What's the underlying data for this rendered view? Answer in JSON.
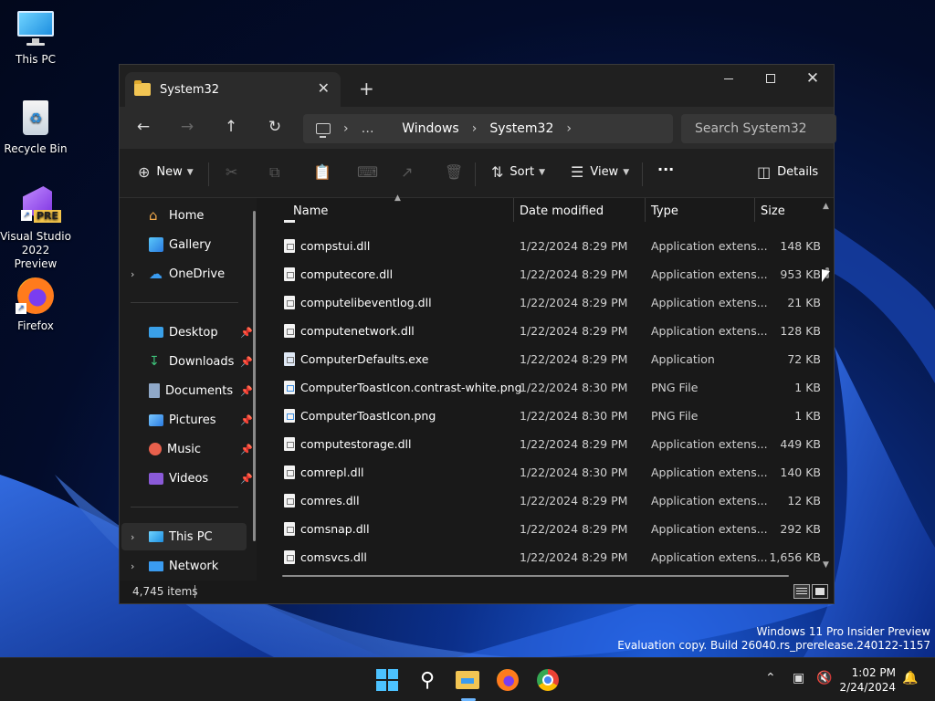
{
  "desktop": {
    "icons": [
      {
        "label": "This PC",
        "icon": "monitor-icon"
      },
      {
        "label": "Recycle Bin",
        "icon": "recycle-bin-icon"
      },
      {
        "label": "Visual Studio 2022 Preview",
        "badge": "PRE",
        "icon": "visual-studio-icon"
      },
      {
        "label": "Firefox",
        "icon": "firefox-icon"
      }
    ],
    "watermark_line1": "Windows 11 Pro Insider Preview",
    "watermark_line2": "Evaluation copy. Build 26040.rs_prerelease.240122-1157"
  },
  "window": {
    "tab_title": "System32",
    "new_tab": "+",
    "breadcrumb": [
      "Windows",
      "System32"
    ],
    "breadcrumb_more": "…",
    "search_placeholder": "Search System32",
    "toolbar": {
      "new_label": "New",
      "sort_label": "Sort",
      "view_label": "View",
      "more_label": "···",
      "details_label": "Details"
    },
    "nav": {
      "home": "Home",
      "gallery": "Gallery",
      "onedrive": "OneDrive",
      "desktop": "Desktop",
      "downloads": "Downloads",
      "documents": "Documents",
      "pictures": "Pictures",
      "music": "Music",
      "videos": "Videos",
      "this_pc": "This PC",
      "network": "Network"
    },
    "columns": {
      "name": "Name",
      "date": "Date modified",
      "type": "Type",
      "size": "Size"
    },
    "files": [
      {
        "name": "compstui.dll",
        "date": "1/22/2024 8:29 PM",
        "type": "Application extens...",
        "size": "148 KB",
        "kind": "dll"
      },
      {
        "name": "computecore.dll",
        "date": "1/22/2024 8:29 PM",
        "type": "Application extens...",
        "size": "953 KB",
        "kind": "dll"
      },
      {
        "name": "computelibeventlog.dll",
        "date": "1/22/2024 8:29 PM",
        "type": "Application extens...",
        "size": "21 KB",
        "kind": "dll"
      },
      {
        "name": "computenetwork.dll",
        "date": "1/22/2024 8:29 PM",
        "type": "Application extens...",
        "size": "128 KB",
        "kind": "dll"
      },
      {
        "name": "ComputerDefaults.exe",
        "date": "1/22/2024 8:29 PM",
        "type": "Application",
        "size": "72 KB",
        "kind": "exe"
      },
      {
        "name": "ComputerToastIcon.contrast-white.png",
        "date": "1/22/2024 8:30 PM",
        "type": "PNG File",
        "size": "1 KB",
        "kind": "png"
      },
      {
        "name": "ComputerToastIcon.png",
        "date": "1/22/2024 8:30 PM",
        "type": "PNG File",
        "size": "1 KB",
        "kind": "png"
      },
      {
        "name": "computestorage.dll",
        "date": "1/22/2024 8:29 PM",
        "type": "Application extens...",
        "size": "449 KB",
        "kind": "dll"
      },
      {
        "name": "comrepl.dll",
        "date": "1/22/2024 8:30 PM",
        "type": "Application extens...",
        "size": "140 KB",
        "kind": "dll"
      },
      {
        "name": "comres.dll",
        "date": "1/22/2024 8:29 PM",
        "type": "Application extens...",
        "size": "12 KB",
        "kind": "dll"
      },
      {
        "name": "comsnap.dll",
        "date": "1/22/2024 8:29 PM",
        "type": "Application extens...",
        "size": "292 KB",
        "kind": "dll"
      },
      {
        "name": "comsvcs.dll",
        "date": "1/22/2024 8:29 PM",
        "type": "Application extens...",
        "size": "1,656 KB",
        "kind": "dll"
      }
    ],
    "status_count": "4,745 items"
  },
  "taskbar": {
    "time": "1:02 PM",
    "date": "2/24/2024"
  },
  "colors": {
    "accent": "#60cdff",
    "folder": "#f2c553",
    "window_bg": "#191919"
  }
}
